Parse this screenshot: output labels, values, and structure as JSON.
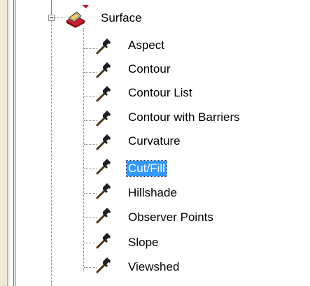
{
  "tree": {
    "parent": {
      "label": "Surface",
      "icon": "surface-toolset-icon",
      "expanded": true
    },
    "children": [
      {
        "label": "Aspect",
        "icon": "hammer-tool-icon"
      },
      {
        "label": "Contour",
        "icon": "hammer-tool-icon"
      },
      {
        "label": "Contour List",
        "icon": "hammer-tool-icon"
      },
      {
        "label": "Contour with Barriers",
        "icon": "hammer-tool-icon"
      },
      {
        "label": "Curvature",
        "icon": "hammer-tool-icon"
      },
      {
        "label": "Cut/Fill",
        "icon": "hammer-tool-icon",
        "selected": true
      },
      {
        "label": "Hillshade",
        "icon": "hammer-tool-icon"
      },
      {
        "label": "Observer Points",
        "icon": "hammer-tool-icon"
      },
      {
        "label": "Slope",
        "icon": "hammer-tool-icon"
      },
      {
        "label": "Viewshed",
        "icon": "hammer-tool-icon"
      }
    ]
  },
  "colors": {
    "selection": "#3399ff",
    "selection_text": "#ffffff",
    "tree_lines": "#7f7f7f",
    "frame": "#ece9d8"
  }
}
